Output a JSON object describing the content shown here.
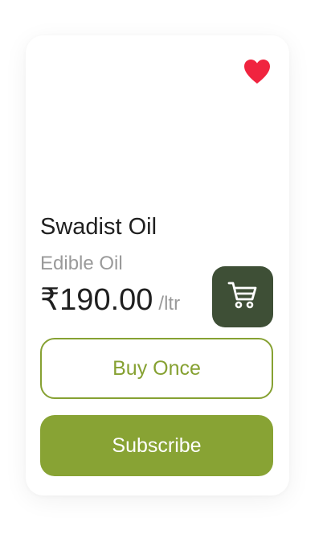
{
  "product": {
    "name": "Swadist Oil",
    "category": "Edible Oil",
    "price": "₹190.00",
    "unit": "/ltr",
    "favorited": true
  },
  "actions": {
    "buy_once_label": "Buy Once",
    "subscribe_label": "Subscribe"
  },
  "icons": {
    "favorite": "heart-icon",
    "cart": "cart-icon"
  },
  "colors": {
    "accent": "#88a334",
    "cart_button": "#3e4f36",
    "heart": "#f0243f"
  }
}
